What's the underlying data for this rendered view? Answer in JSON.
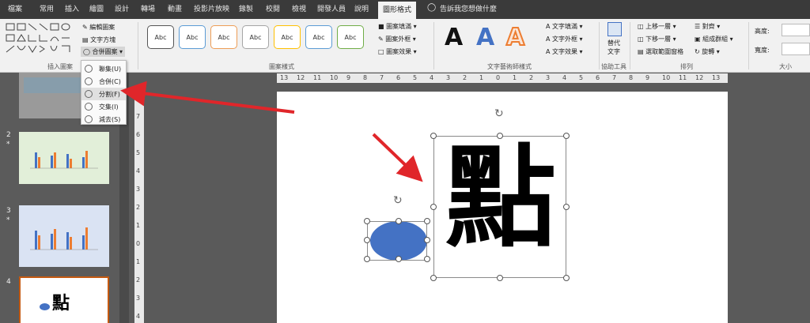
{
  "tabs": [
    "檔案",
    "常用",
    "插入",
    "繪圖",
    "設計",
    "轉場",
    "動畫",
    "投影片放映",
    "錄製",
    "校閱",
    "檢視",
    "開發人員",
    "說明",
    "圖形格式",
    "告訴我您想做什麼"
  ],
  "ribbon": {
    "insert_shapes_label": "插入圖案",
    "edit_shape": "編輯圖案",
    "text_box": "文字方塊",
    "merge_shapes": "合併圖案",
    "shape_styles_label": "圖案樣式",
    "style_text": "Abc",
    "shape_fill": "圖案填滿",
    "shape_outline": "圖案外框",
    "shape_effects": "圖案效果",
    "wordart_label": "文字藝術師樣式",
    "wordart_letter": "A",
    "text_fill": "文字填滿",
    "text_outline": "文字外框",
    "text_effects": "文字效果",
    "alt_text_line1": "替代",
    "alt_text_line2": "文字",
    "accessibility_label": "協助工具",
    "bring_forward": "上移一層",
    "send_backward": "下移一層",
    "selection_pane": "選取範圍窗格",
    "align": "對齊",
    "group": "組成群組",
    "rotate": "旋轉",
    "arrange_label": "排列",
    "height_label": "高度:",
    "width_label": "寬度:",
    "size_label": "大小"
  },
  "merge_menu": [
    {
      "label": "聯集(U)"
    },
    {
      "label": "合併(C)"
    },
    {
      "label": "分割(F)"
    },
    {
      "label": "交集(I)"
    },
    {
      "label": "減去(S)"
    }
  ],
  "slides": [
    {
      "num": "2",
      "star": "*"
    },
    {
      "num": "3",
      "star": "*"
    },
    {
      "num": "4",
      "star": ""
    }
  ],
  "slide_canvas": {
    "char": "點"
  },
  "ruler_numbers": [
    "13",
    "12",
    "11",
    "10",
    "9",
    "8",
    "7",
    "6",
    "5",
    "4",
    "3",
    "2",
    "1",
    "0",
    "1",
    "2",
    "3",
    "4",
    "5",
    "6",
    "7",
    "8",
    "9",
    "10",
    "11",
    "12",
    "13"
  ],
  "vruler_numbers": [
    "8",
    "7",
    "6",
    "5",
    "4",
    "3",
    "2",
    "1",
    "0",
    "1",
    "2",
    "3",
    "4"
  ],
  "colors": {
    "ellipse": "#4472c4",
    "arrow": "#e0262a",
    "tab_bar": "#3a3a3a"
  }
}
